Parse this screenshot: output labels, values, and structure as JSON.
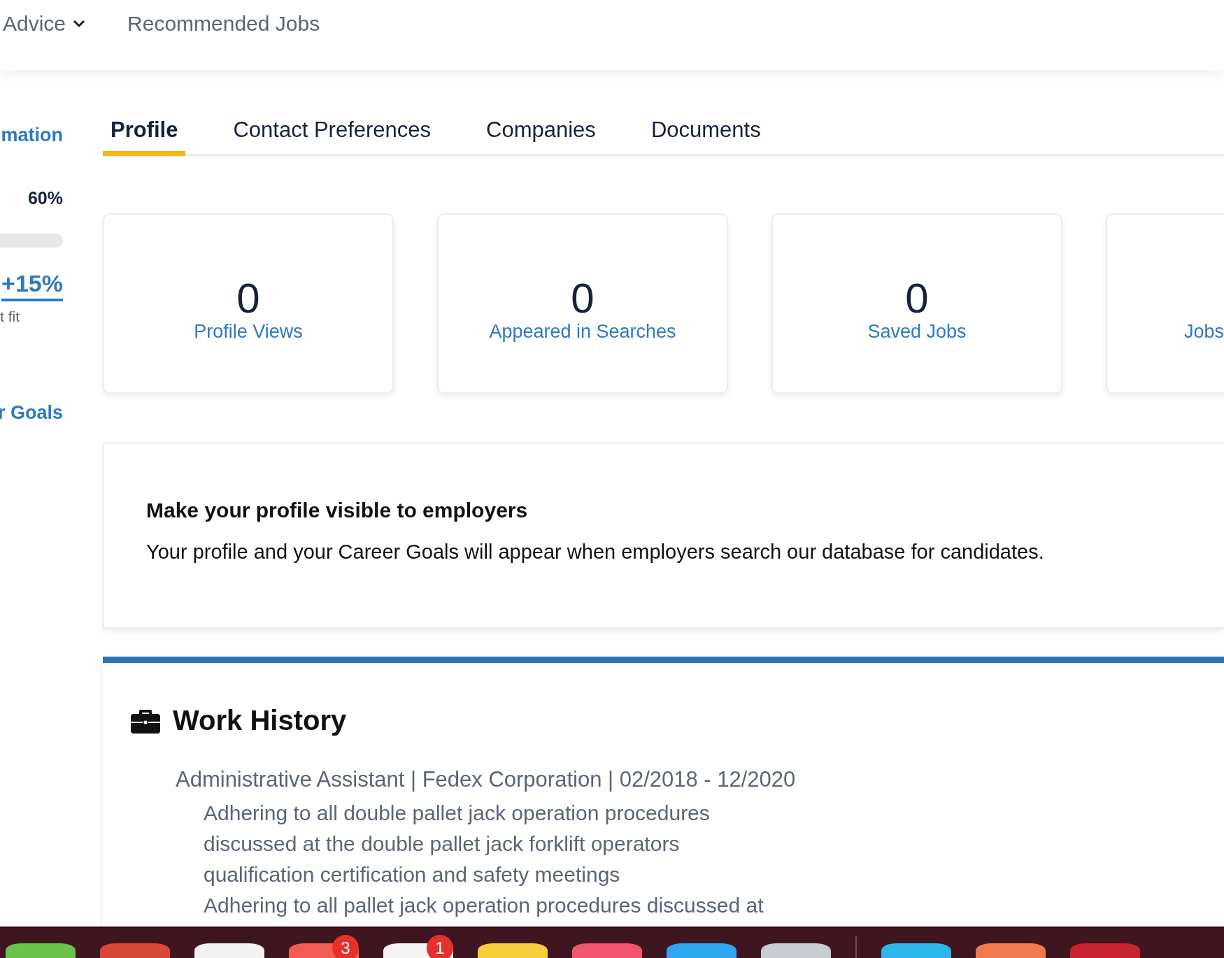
{
  "top_nav": {
    "items": [
      {
        "label": "Advice",
        "dropdown": true
      },
      {
        "label": "Recommended Jobs",
        "dropdown": false
      }
    ]
  },
  "sidebar": {
    "section_link": "mation",
    "completion": "60%",
    "boost": "+15%",
    "boost_note": "t fit",
    "goals_link": "r Goals"
  },
  "tabs": [
    {
      "label": "Profile",
      "selected": true
    },
    {
      "label": "Contact Preferences",
      "selected": false
    },
    {
      "label": "Companies",
      "selected": false
    },
    {
      "label": "Documents",
      "selected": false
    }
  ],
  "stats": [
    {
      "value": "0",
      "label": "Profile Views"
    },
    {
      "value": "0",
      "label": "Appeared in Searches"
    },
    {
      "value": "0",
      "label": "Saved Jobs"
    },
    {
      "label": "Jobs"
    }
  ],
  "visibility": {
    "title": "Make your profile visible to employers",
    "text": "Your profile and your Career Goals will appear when employers search our database for candidates."
  },
  "work_history": {
    "title": "Work History",
    "jobs": [
      {
        "heading": "Administrative Assistant | Fedex Corporation | 02/2018 - 12/2020",
        "duties": [
          "Adhering to all double pallet jack operation procedures discussed at the double pallet jack forklift operators qualification certification and safety meetings",
          "Adhering to all pallet jack operation procedures discussed at"
        ]
      }
    ]
  },
  "dock": {
    "apps": [
      {
        "color": "#6cc24a"
      },
      {
        "color": "#d9473a"
      },
      {
        "color": "#f2f2f2"
      },
      {
        "color": "#f25c54",
        "badge": "3"
      },
      {
        "color": "#f4f4f4",
        "badge": "1"
      },
      {
        "color": "#f7cf3c"
      },
      {
        "color": "#f2556e"
      },
      {
        "color": "#2ea8f0"
      },
      {
        "color": "#c9ccd1"
      },
      {
        "color": "#2db6e8",
        "separator_before": true
      },
      {
        "color": "#ee7a4e"
      },
      {
        "color": "#c8232f"
      }
    ]
  }
}
